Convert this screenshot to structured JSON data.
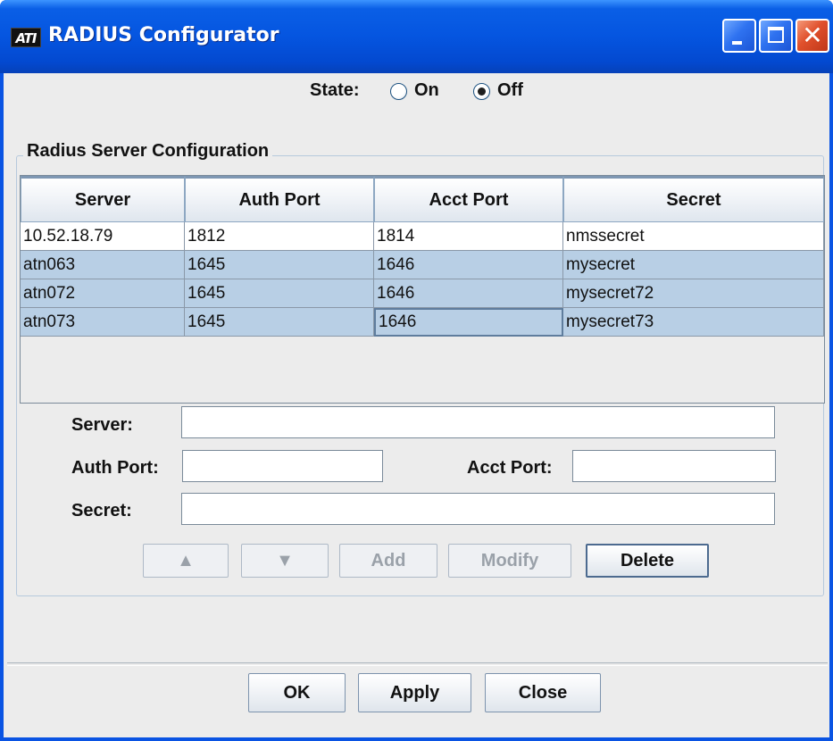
{
  "window": {
    "title": "RADIUS Configurator",
    "logo_text": "ATI",
    "controls": {
      "minimize": "minimize-icon",
      "maximize": "maximize-icon",
      "close": "close-icon"
    }
  },
  "state": {
    "label": "State:",
    "options": [
      {
        "label": "On",
        "selected": false
      },
      {
        "label": "Off",
        "selected": true
      }
    ]
  },
  "group": {
    "title": "Radius Server Configuration"
  },
  "table": {
    "columns": [
      "Server",
      "Auth Port",
      "Acct Port",
      "Secret"
    ],
    "rows": [
      {
        "server": "10.52.18.79",
        "auth_port": "1812",
        "acct_port": "1814",
        "secret": "nmssecret",
        "selected": false
      },
      {
        "server": "atn063",
        "auth_port": "1645",
        "acct_port": "1646",
        "secret": "mysecret",
        "selected": true
      },
      {
        "server": "atn072",
        "auth_port": "1645",
        "acct_port": "1646",
        "secret": "mysecret72",
        "selected": true
      },
      {
        "server": "atn073",
        "auth_port": "1645",
        "acct_port": "1646",
        "secret": "mysecret73",
        "selected": true
      }
    ]
  },
  "form": {
    "server_label": "Server:",
    "server_value": "",
    "auth_port_label": "Auth Port:",
    "auth_port_value": "",
    "acct_port_label": "Acct Port:",
    "acct_port_value": "",
    "secret_label": "Secret:",
    "secret_value": ""
  },
  "row_buttons": {
    "up": "▲",
    "down": "▼",
    "add": "Add",
    "modify": "Modify",
    "delete": "Delete"
  },
  "dialog_buttons": {
    "ok": "OK",
    "apply": "Apply",
    "close": "Close"
  },
  "colors": {
    "titlebar": "#0555e0",
    "selection": "#b8cfe5",
    "panel": "#ececec"
  }
}
